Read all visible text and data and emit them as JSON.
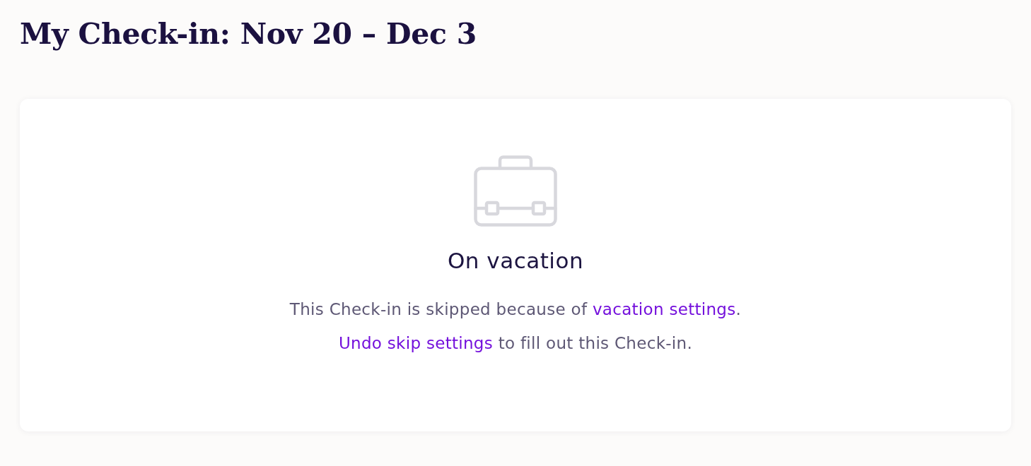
{
  "page": {
    "title": "My Check-in: Nov 20 – Dec 3"
  },
  "status_card": {
    "title": "On vacation",
    "message_lines": [
      {
        "segments": [
          {
            "kind": "text",
            "text": "This Check-in is skipped because of "
          },
          {
            "kind": "link",
            "text": "vacation settings"
          },
          {
            "kind": "text",
            "text": "."
          }
        ]
      },
      {
        "segments": [
          {
            "kind": "link",
            "text": "Undo skip settings"
          },
          {
            "kind": "text",
            "text": " to fill out this Check-in."
          }
        ]
      }
    ]
  }
}
